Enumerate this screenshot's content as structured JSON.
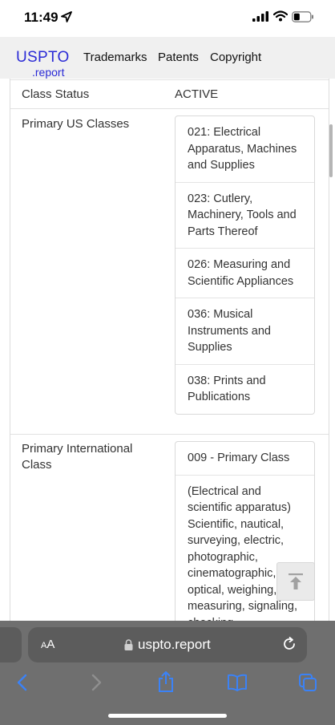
{
  "status_bar": {
    "time": "11:49"
  },
  "nav": {
    "logo": "USPTO",
    "logo_sub": ".report",
    "links": [
      "Trademarks",
      "Patents",
      "Copyright"
    ]
  },
  "details": {
    "class_status_label": "Class Status",
    "class_status_value": "ACTIVE",
    "primary_us_classes_label": "Primary US Classes",
    "primary_us_classes": [
      "021: Electrical Apparatus, Machines and Supplies",
      "023: Cutlery, Machinery, Tools and Parts Thereof",
      "026: Measuring and Scientific Appliances",
      "036: Musical Instruments and Supplies",
      "038: Prints and Publications"
    ],
    "primary_international_label": "Primary International Class",
    "international_class": "009 - Primary Class",
    "international_description": "(Electrical and scientific apparatus) Scientific, nautical, surveying, electric, photographic, cinematographic, optical, weighing, measuring, signaling, checking"
  },
  "browser": {
    "text_size_label": "AA",
    "url": "uspto.report"
  },
  "icons": {
    "location_arrow": "location-arrow-icon",
    "signal": "signal-icon",
    "wifi": "wifi-icon",
    "battery": "battery-icon",
    "lock": "lock-icon",
    "reload": "reload-icon",
    "back_to_top": "arrow-up-to-line-icon",
    "back": "chevron-left-icon",
    "forward": "chevron-right-icon",
    "share": "share-icon",
    "bookmarks": "book-icon",
    "tabs": "tabs-icon"
  }
}
